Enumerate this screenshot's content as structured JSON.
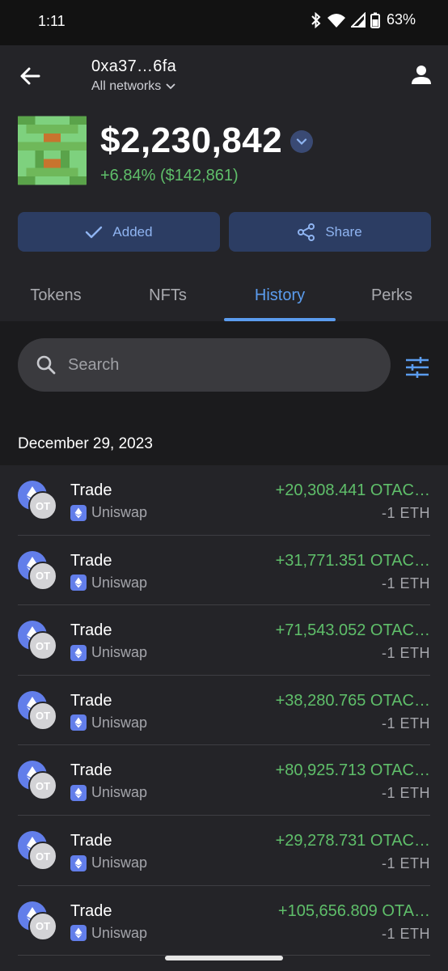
{
  "status_bar": {
    "time": "1:11",
    "battery": "63%"
  },
  "header": {
    "address": "0xa37…6fa",
    "network": "All networks",
    "balance": "$2,230,842",
    "change": "+6.84% ($142,861)",
    "added_label": "Added",
    "share_label": "Share"
  },
  "tabs": [
    "Tokens",
    "NFTs",
    "History",
    "Perks"
  ],
  "active_tab": "History",
  "search": {
    "placeholder": "Search"
  },
  "history": {
    "date": "December 29, 2023",
    "rows": [
      {
        "title": "Trade",
        "source": "Uniswap",
        "amount": "+20,308.441 OTAC…",
        "eth": "-1  ETH"
      },
      {
        "title": "Trade",
        "source": "Uniswap",
        "amount": "+31,771.351 OTAC…",
        "eth": "-1  ETH"
      },
      {
        "title": "Trade",
        "source": "Uniswap",
        "amount": "+71,543.052 OTAC…",
        "eth": "-1  ETH"
      },
      {
        "title": "Trade",
        "source": "Uniswap",
        "amount": "+38,280.765 OTAC…",
        "eth": "-1  ETH"
      },
      {
        "title": "Trade",
        "source": "Uniswap",
        "amount": "+80,925.713 OTAC…",
        "eth": "-1  ETH"
      },
      {
        "title": "Trade",
        "source": "Uniswap",
        "amount": "+29,278.731 OTAC…",
        "eth": "-1  ETH"
      },
      {
        "title": "Trade",
        "source": "Uniswap",
        "amount": "+105,656.809 OTA…",
        "eth": "-1  ETH"
      }
    ],
    "token_badge": "OT"
  },
  "colors": {
    "accent": "#5b9cee",
    "positive": "#5fbf6a",
    "button_bg": "#2c3d63",
    "eth": "#627eea"
  }
}
